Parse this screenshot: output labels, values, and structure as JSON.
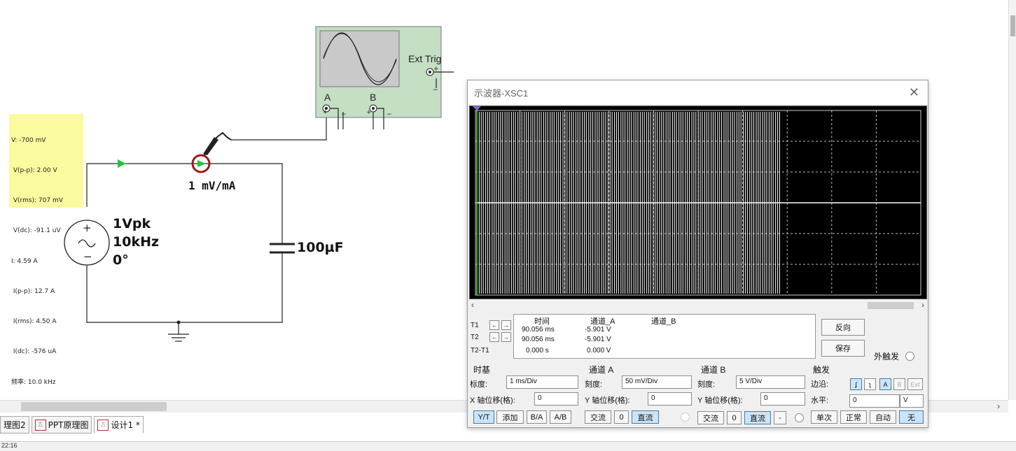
{
  "probe": {
    "lines": [
      "V: -700 mV",
      " V(p-p): 2.00 V",
      " V(rms): 707 mV",
      " V(dc): -91.1 uV",
      "I: 4.59 A",
      " I(p-p): 12.7 A",
      " I(rms): 4.50 A",
      " I(dc): -576 uA",
      "频率: 10.0 kHz"
    ],
    "scale_label": "1 mV/mA"
  },
  "source": {
    "amplitude": "1Vpk",
    "frequency": "10kHz",
    "phase": "0°"
  },
  "capacitor": {
    "value": "100µF"
  },
  "scope_symbol": {
    "ext_trig": "Ext Trig",
    "channel_a": "A",
    "channel_b": "B"
  },
  "oscilloscope": {
    "title": "示波器-XSC1",
    "close": "✕",
    "cursors": {
      "t1": "T1",
      "t2": "T2",
      "t2t1": "T2-T1",
      "left_arrow": "←",
      "right_arrow": "→",
      "headers": {
        "time": "时间",
        "channel_a": "通道_A",
        "channel_b": "通道_B"
      },
      "rows": [
        {
          "time": "90.056 ms",
          "channel_a": "-5.901 V"
        },
        {
          "time": "90.056 ms",
          "channel_a": "-5.901 V"
        },
        {
          "time": "0.000 s",
          "channel_a": "0.000 V"
        }
      ]
    },
    "reverse_button": "反向",
    "save_button": "保存",
    "ext_trigger_label": "外触发",
    "timebase": {
      "title": "时基",
      "scale_label": "标度:",
      "scale_value": "1 ms/Div",
      "xpos_label": "X 轴位移(格):",
      "xpos_value": "0",
      "buttons": [
        "Y/T",
        "添加",
        "B/A",
        "A/B"
      ]
    },
    "channel_a": {
      "title": "通道 A",
      "scale_label": "刻度:",
      "scale_value": "50 mV/Div",
      "ypos_label": "Y 轴位移(格):",
      "ypos_value": "0",
      "buttons": [
        "交流",
        "0",
        "直流"
      ]
    },
    "channel_b": {
      "title": "通道 B",
      "scale_label": "刻度:",
      "scale_value": "5  V/Div",
      "ypos_label": "Y 轴位移(格):",
      "ypos_value": "0",
      "buttons": [
        "交流",
        "0",
        "直流",
        "-"
      ]
    },
    "trigger": {
      "title": "触发",
      "edge_label": "边沿:",
      "edge_buttons": [
        "ʄ",
        "ʅ",
        "A",
        "B",
        "Ext"
      ],
      "level_label": "水平:",
      "level_value": "0",
      "level_unit": "V",
      "mode_buttons": [
        "单次",
        "正常",
        "自动",
        "无"
      ]
    }
  },
  "tabs": [
    "理图2",
    "PPT原理图",
    "设计1 *"
  ],
  "statusbar": {
    "text": "22:16"
  },
  "scroll": {
    "right": "›",
    "left": "‹"
  }
}
